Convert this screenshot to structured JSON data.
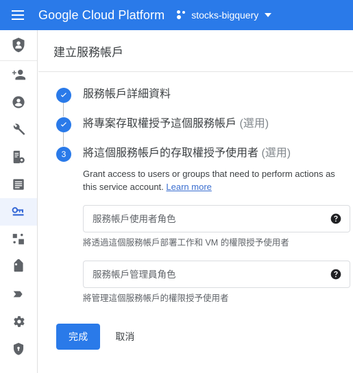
{
  "topbar": {
    "menu_icon": "hamburger-menu-icon",
    "brand": "Google Cloud Platform",
    "project_icon": "project-dots-icon",
    "project_name": "stocks-bigquery",
    "caret_icon": "chevron-down-icon",
    "bg_color": "#2a7ae9"
  },
  "sidebar": {
    "header_icon": "shield-person-icon",
    "items": [
      {
        "icon": "person-add-icon",
        "selected": false
      },
      {
        "icon": "account-circle-icon",
        "selected": false
      },
      {
        "icon": "wrench-icon",
        "selected": false
      },
      {
        "icon": "document-settings-icon",
        "selected": false
      },
      {
        "icon": "article-list-icon",
        "selected": false
      },
      {
        "icon": "key-icon",
        "selected": true
      },
      {
        "icon": "dashboard-squares-icon",
        "selected": false
      },
      {
        "icon": "label-tag-icon",
        "selected": false
      },
      {
        "icon": "chevron-tag-icon",
        "selected": false
      },
      {
        "icon": "gear-icon",
        "selected": false
      },
      {
        "icon": "shield-icon",
        "selected": false
      }
    ],
    "selected_bg": "#eef3fd",
    "selected_fg": "#3367d6"
  },
  "main": {
    "page_title": "建立服務帳戶",
    "steps": [
      {
        "marker": "check",
        "label": "服務帳戶詳細資料",
        "optional": "",
        "state": "complete"
      },
      {
        "marker": "check",
        "label": "將專案存取權授予這個服務帳戶",
        "optional": "(選用)",
        "state": "complete"
      },
      {
        "marker": "3",
        "label": "將這個服務帳戶的存取權授予使用者",
        "optional": "(選用)",
        "state": "active"
      }
    ],
    "description": "Grant access to users or groups that need to perform actions as this service account.",
    "learn_more": "Learn more",
    "fields": [
      {
        "placeholder": "服務帳戶使用者角色",
        "value": "",
        "hint": "將透過這個服務帳戶部署工作和 VM 的權限授予使用者",
        "help_icon": "help-icon"
      },
      {
        "placeholder": "服務帳戶管理員角色",
        "value": "",
        "hint": "將管理這個服務帳戶的權限授予使用者",
        "help_icon": "help-icon"
      }
    ],
    "done_label": "完成",
    "cancel_label": "取消"
  }
}
